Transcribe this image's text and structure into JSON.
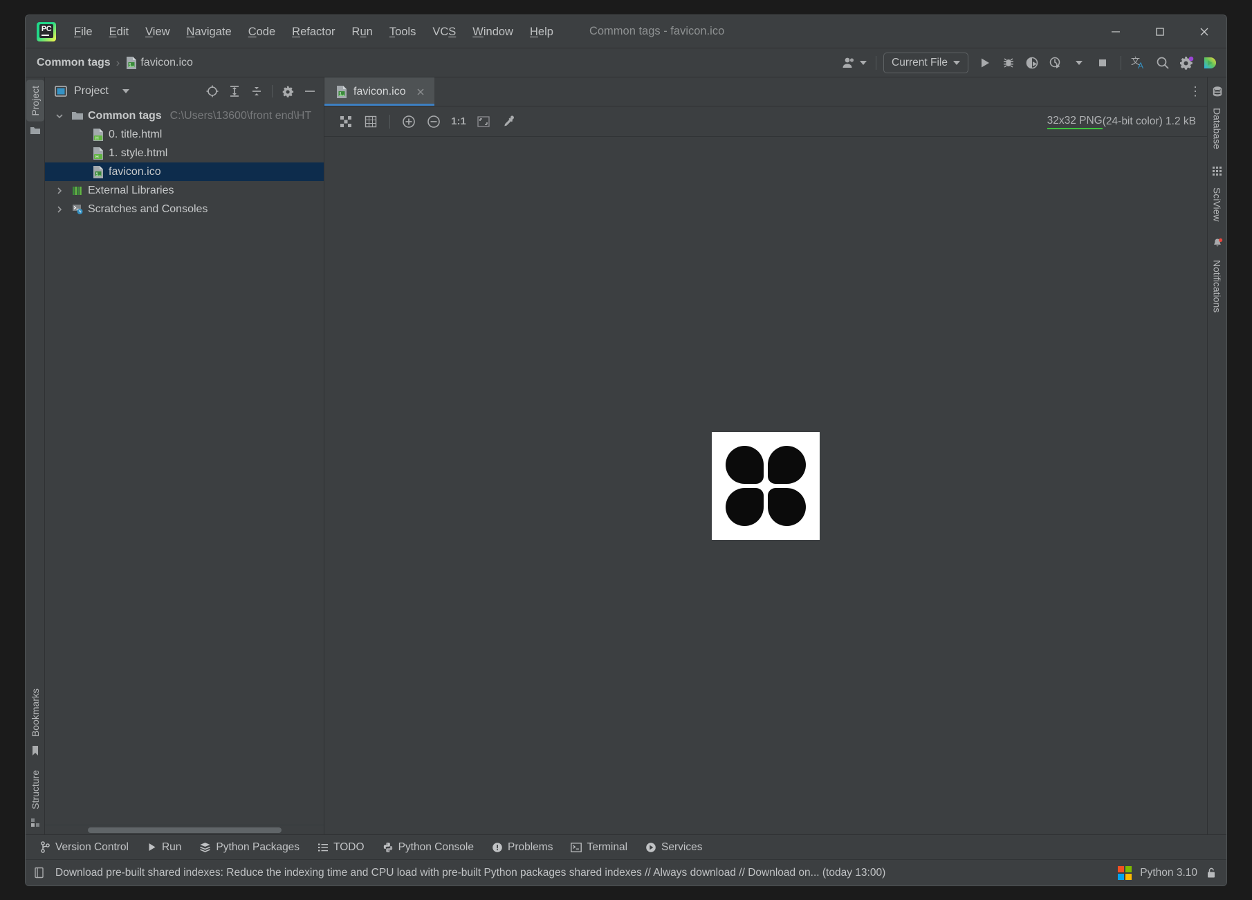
{
  "window": {
    "title": "Common tags - favicon.ico",
    "app_logo": "pycharm-logo",
    "controls": {
      "minimize": "minimize-icon",
      "maximize": "maximize-icon",
      "close": "close-icon"
    }
  },
  "menu": {
    "items": [
      {
        "label": "File",
        "mnemonic": "F"
      },
      {
        "label": "Edit",
        "mnemonic": "E"
      },
      {
        "label": "View",
        "mnemonic": "V"
      },
      {
        "label": "Navigate",
        "mnemonic": "N"
      },
      {
        "label": "Code",
        "mnemonic": "C"
      },
      {
        "label": "Refactor",
        "mnemonic": "R"
      },
      {
        "label": "Run",
        "mnemonic": "u"
      },
      {
        "label": "Tools",
        "mnemonic": "T"
      },
      {
        "label": "VCS",
        "mnemonic": "S"
      },
      {
        "label": "Window",
        "mnemonic": "W"
      },
      {
        "label": "Help",
        "mnemonic": "H"
      }
    ]
  },
  "navbar": {
    "breadcrumb": {
      "project": "Common tags",
      "separator": "›",
      "file": "favicon.ico"
    },
    "run_config": {
      "label": "Current File"
    },
    "buttons": {
      "account": "account-icon",
      "run": "run-icon",
      "debug": "debug-icon",
      "run_coverage": "run-with-coverage-icon",
      "profile": "profiler-icon",
      "more": "chevron-down-icon",
      "stop": "stop-icon",
      "translate": "translate-icon",
      "search": "search-icon",
      "settings": "gear-icon",
      "updates": "ide-updates-icon"
    }
  },
  "left_strip": {
    "top": [
      {
        "label": "Project",
        "icon": "folder-icon",
        "active": true
      }
    ],
    "bottom": [
      {
        "label": "Bookmarks",
        "icon": "bookmark-icon",
        "active": false
      },
      {
        "label": "Structure",
        "icon": "structure-icon",
        "active": false
      }
    ]
  },
  "right_strip": [
    {
      "label": "Database",
      "icon": "database-icon"
    },
    {
      "label": "SciView",
      "icon": "sciview-grid-icon"
    },
    {
      "label": "Notifications",
      "icon": "bell-icon",
      "badge": true
    }
  ],
  "project_panel": {
    "title": "Project",
    "view_dropdown": "chevron-down-icon",
    "actions": [
      {
        "name": "select-opened-file",
        "icon": "crosshair-icon"
      },
      {
        "name": "expand-all",
        "icon": "expand-all-icon"
      },
      {
        "name": "collapse-all",
        "icon": "collapse-all-icon"
      },
      {
        "name": "settings",
        "icon": "gear-icon"
      },
      {
        "name": "hide",
        "icon": "minus-icon"
      }
    ],
    "tree": [
      {
        "label": "Common tags",
        "path": "C:\\Users\\13600\\front end\\HT",
        "icon": "folder-icon",
        "expanded": true,
        "bold": true,
        "level": 0,
        "selected": false
      },
      {
        "label": "0. title.html",
        "icon": "html-file-icon",
        "level": 1,
        "selected": false
      },
      {
        "label": "1. style.html",
        "icon": "html-file-icon",
        "level": 1,
        "selected": false
      },
      {
        "label": "favicon.ico",
        "icon": "image-file-icon",
        "level": 1,
        "selected": true
      },
      {
        "label": "External Libraries",
        "icon": "libraries-icon",
        "expanded": false,
        "level": 0,
        "selected": false
      },
      {
        "label": "Scratches and Consoles",
        "icon": "scratches-icon",
        "expanded": false,
        "level": 0,
        "selected": false
      }
    ]
  },
  "editor": {
    "tabs": [
      {
        "label": "favicon.ico",
        "icon": "image-file-icon",
        "active": true,
        "close": "close-icon"
      }
    ],
    "tab_options": "more-options-icon",
    "image_toolbar": [
      {
        "name": "toggle-transparency-chessboard",
        "icon": "checkerboard-icon"
      },
      {
        "name": "toggle-grid",
        "icon": "grid-icon"
      },
      {
        "name": "zoom-in",
        "icon": "zoom-in-icon"
      },
      {
        "name": "zoom-out",
        "icon": "zoom-out-icon"
      },
      {
        "name": "actual-size",
        "icon": "one-to-one-icon",
        "label": "1:1"
      },
      {
        "name": "fit-to-window",
        "icon": "fit-content-icon"
      },
      {
        "name": "color-picker",
        "icon": "eyedropper-icon"
      }
    ],
    "image_info": {
      "highlighted": "32x32 PNG",
      "rest": " (24-bit color) 1.2 kB"
    },
    "preview": {
      "name": "favicon-preview",
      "background": "#ffffff",
      "shape_color": "#0b0b0b",
      "shapes": 4
    }
  },
  "bottom_toolwindows": [
    {
      "label": "Version Control",
      "icon": "branch-icon"
    },
    {
      "label": "Run",
      "icon": "run-icon"
    },
    {
      "label": "Python Packages",
      "icon": "packages-icon"
    },
    {
      "label": "TODO",
      "icon": "todo-list-icon"
    },
    {
      "label": "Python Console",
      "icon": "python-icon"
    },
    {
      "label": "Problems",
      "icon": "problems-icon"
    },
    {
      "label": "Terminal",
      "icon": "terminal-icon"
    },
    {
      "label": "Services",
      "icon": "services-icon"
    }
  ],
  "statusbar": {
    "notification_icon": "ide-notification-icon",
    "message": "Download pre-built shared indexes: Reduce the indexing time and CPU load with pre-built Python packages shared indexes // Always download // Download on... (today 13:00)",
    "os_icon": "windows-logo",
    "interpreter": "Python 3.10",
    "lock_icon": "unlocked-padlock-icon"
  },
  "colors": {
    "accent": "#3d7fc1",
    "selection": "#0d2c4c",
    "panel": "#3c3f41",
    "toolbar": "#4e5254",
    "highlight_underline": "#3ec33e"
  }
}
